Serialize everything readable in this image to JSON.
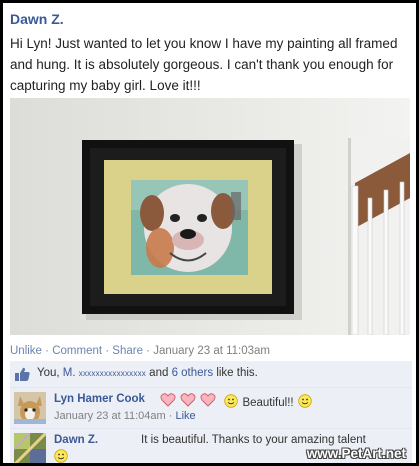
{
  "post": {
    "author": "Dawn Z.",
    "text": "Hi Lyn! Just wanted to let you know I have my painting all framed and hung. It is absolutely gorgeous. I can't thank you enough for capturing my baby girl. Love it!!!"
  },
  "actions": {
    "unlike": "Unlike",
    "sep1": " · ",
    "comment": "Comment",
    "sep2": " · ",
    "share": "Share",
    "sep3": " · ",
    "timestamp": "January 23 at 11:03am"
  },
  "likes": {
    "prefix": "You, ",
    "name_initial": "M.",
    "name_masked": "xxxxxxxxxxxxxxxx",
    "and": " and ",
    "others": "6 others",
    "suffix": " like this."
  },
  "comments": [
    {
      "name": "Lyn Hamer Cook",
      "text": "Beautiful!!",
      "time": "January 23 at 11:04am",
      "sep": " · ",
      "like": "Like"
    },
    {
      "name": "Dawn Z.",
      "text": "It is beautiful. Thanks to your amazing talent"
    }
  ],
  "watermark": "www.PetArt.net",
  "colors": {
    "link": "#3b5998",
    "comment_bg": "#eceff5",
    "meta": "#808080"
  },
  "icons": [
    "like-thumb-icon",
    "heart-icon",
    "smiley-icon"
  ]
}
